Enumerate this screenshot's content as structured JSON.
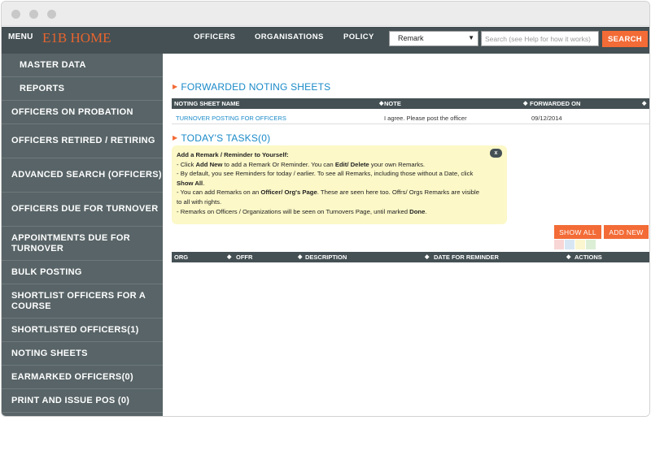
{
  "topbar": {
    "menu_label": "MENU",
    "home_title": "E1B HOME",
    "nav": [
      "OFFICERS",
      "ORGANISATIONS",
      "POLICY"
    ],
    "select_value": "Remark",
    "search_placeholder": "Search (see Help for how it works)",
    "search_button": "SEARCH"
  },
  "sidebar": {
    "items": [
      "MASTER DATA",
      "REPORTS",
      "OFFICERS ON PROBATION",
      "OFFICERS RETIRED / RETIRING",
      "ADVANCED SEARCH (OFFICERS)",
      "OFFICERS DUE FOR TURNOVER",
      "APPOINTMENTS DUE FOR TURNOVER",
      "BULK POSTING",
      "SHORTLIST OFFICERS FOR A COURSE",
      "SHORTLISTED OFFICERS(1)",
      "NOTING SHEETS",
      "EARMARKED OFFICERS(0)",
      "PRINT AND ISSUE POS (0)"
    ]
  },
  "forwarded": {
    "title": "FORWARDED NOTING SHEETS",
    "columns": [
      "NOTING SHEET NAME",
      "NOTE",
      "FORWARDED ON"
    ],
    "rows": [
      [
        "TURNOVER POSTING FOR OFFICERS",
        "I agree. Please post the officer",
        "09/12/2014"
      ]
    ]
  },
  "tasks": {
    "title": "TODAY'S TASKS(0)",
    "close": "x",
    "heading": "Add a Remark / Reminder to Yourself:",
    "l1_a": "- Click ",
    "l1_b": "Add New",
    "l1_c": " to add a Remark Or Reminder. You can ",
    "l1_d": "Edit/ Delete",
    "l1_e": " your own Remarks.",
    "l2_a": "- By default, you see Reminders for today / earlier. To see all Remarks, including those without a Date, click",
    "l2_b": "Show All",
    "l2_c": ".",
    "l3_a": "- You can add Remarks on an ",
    "l3_b": "Officer/ Org's Page",
    "l3_c": ". These are seen here too. Offrs/ Orgs Remarks are visible",
    "l3_d": "to all with rights.",
    "l4_a": "- Remarks on Officers / Organizations will be seen on Turnovers Page, until marked ",
    "l4_b": "Done",
    "l4_c": ".",
    "show_all": "SHOW ALL",
    "add_new": "ADD NEW",
    "swatch_colors": [
      "#f8d6d6",
      "#d8e6f4",
      "#fbf6cf",
      "#dcefd6"
    ],
    "columns": [
      "ORG",
      "OFFR",
      "DESCRIPTION",
      "DATE FOR REMINDER",
      "ACTIONS"
    ]
  }
}
